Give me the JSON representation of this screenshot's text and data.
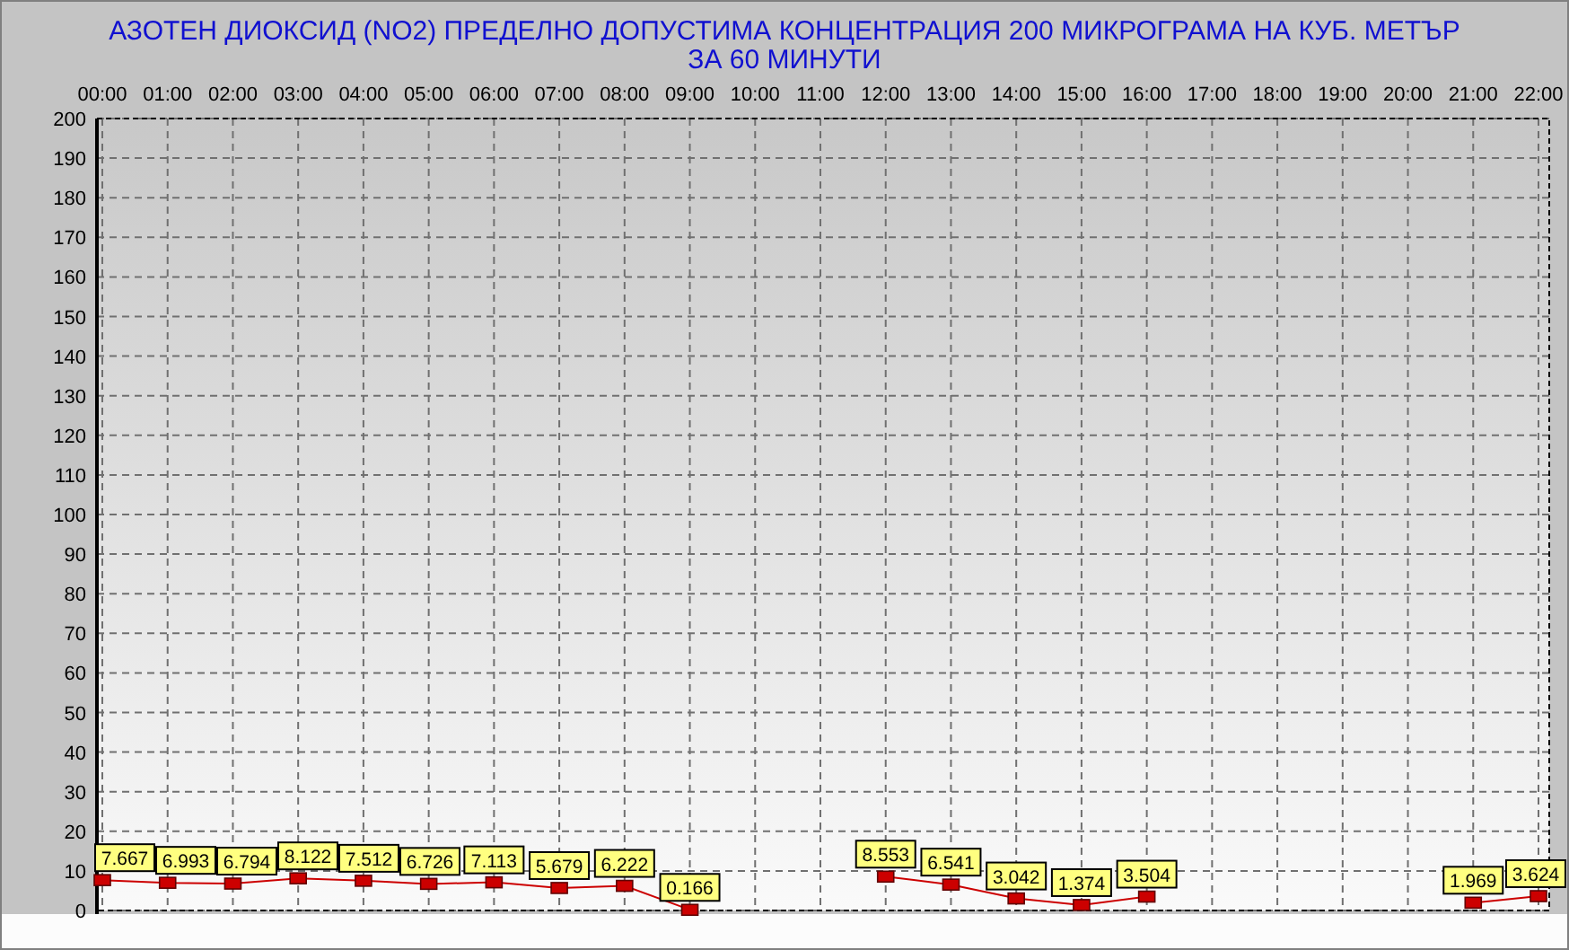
{
  "title_lines": [
    "АЗОТЕН ДИОКСИД   (NO2)     ПРЕДЕЛНО ДОПУСТИМА КОНЦЕНТРАЦИЯ 200 МИКРОГРАМА  НА КУБ. МЕТЪР",
    "ЗА 60 МИНУТИ"
  ],
  "chart_data": {
    "type": "line",
    "data_labels": true,
    "grid": true,
    "categories": [
      "00:00",
      "01:00",
      "02:00",
      "03:00",
      "04:00",
      "05:00",
      "06:00",
      "07:00",
      "08:00",
      "09:00",
      "10:00",
      "11:00",
      "12:00",
      "13:00",
      "14:00",
      "15:00",
      "16:00",
      "17:00",
      "18:00",
      "19:00",
      "20:00",
      "21:00",
      "22:00"
    ],
    "series": [
      {
        "color": "#cc0000",
        "marker": "square",
        "values": [
          7.667,
          6.993,
          6.794,
          8.122,
          7.512,
          6.726,
          7.113,
          5.679,
          6.222,
          0.166,
          null,
          null,
          8.553,
          6.541,
          3.042,
          1.374,
          3.504,
          null,
          null,
          null,
          null,
          1.969,
          3.624
        ]
      }
    ],
    "ylim": [
      0,
      200
    ],
    "yticks": [
      0,
      10,
      20,
      30,
      40,
      50,
      60,
      70,
      80,
      90,
      100,
      110,
      120,
      130,
      140,
      150,
      160,
      170,
      180,
      190,
      200
    ]
  }
}
